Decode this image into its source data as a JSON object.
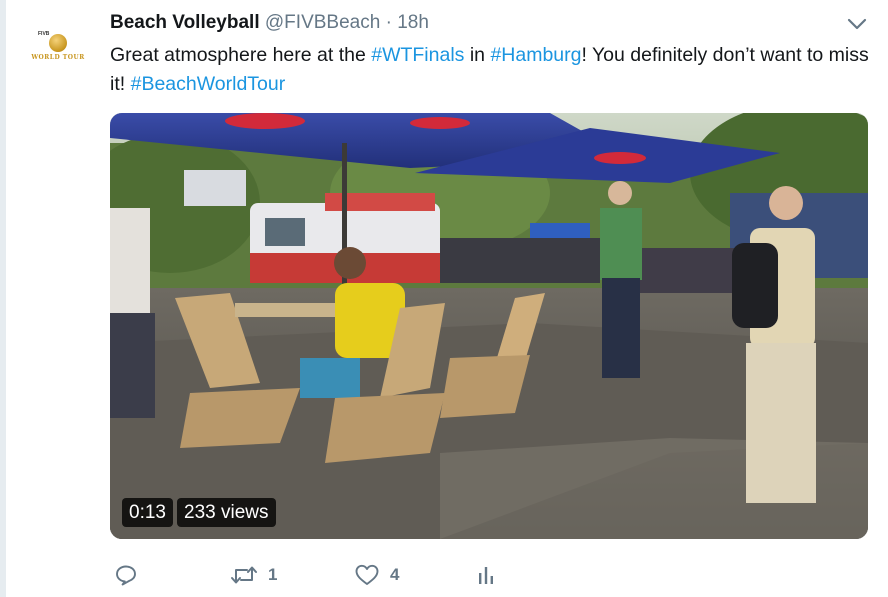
{
  "tweet": {
    "author_name": "Beach Volleyball",
    "handle": "@FIVBBeach",
    "separator": "·",
    "time": "18h",
    "text_parts": {
      "p1": "Great atmosphere here at the ",
      "h1": "#WTFinals",
      "p2": " in ",
      "h2": "#Hamburg",
      "p3": "! You definitely don’t want to miss it! ",
      "h3": "#BeachWorldTour"
    },
    "avatar": {
      "logo_top": "FIVB",
      "logo_bottom": "WORLD TOUR"
    }
  },
  "video": {
    "duration": "0:13",
    "views": "233 views"
  },
  "actions": {
    "reply_count": "",
    "retweet_count": "1",
    "like_count": "4"
  },
  "icons": {
    "menu": "chevron-down-icon",
    "reply": "reply-icon",
    "retweet": "retweet-icon",
    "like": "heart-icon",
    "analytics": "analytics-icon"
  },
  "colors": {
    "link": "#1b95e0",
    "muted": "#657786",
    "text": "#14171a"
  }
}
